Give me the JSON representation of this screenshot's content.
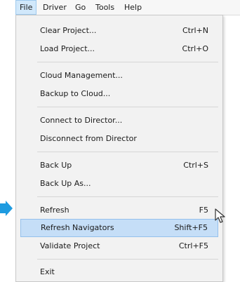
{
  "menubar": {
    "items": [
      {
        "label": "File"
      },
      {
        "label": "Driver"
      },
      {
        "label": "Go"
      },
      {
        "label": "Tools"
      },
      {
        "label": "Help"
      }
    ]
  },
  "file_menu": {
    "items": [
      {
        "label": "Clear Project...",
        "shortcut": "Ctrl+N"
      },
      {
        "label": "Load Project...",
        "shortcut": "Ctrl+O"
      },
      {
        "label": "Cloud Management...",
        "shortcut": ""
      },
      {
        "label": "Backup to Cloud...",
        "shortcut": ""
      },
      {
        "label": "Connect to Director...",
        "shortcut": ""
      },
      {
        "label": "Disconnect from Director",
        "shortcut": ""
      },
      {
        "label": "Back Up",
        "shortcut": "Ctrl+S"
      },
      {
        "label": "Back Up As...",
        "shortcut": ""
      },
      {
        "label": "Refresh",
        "shortcut": "F5"
      },
      {
        "label": "Refresh Navigators",
        "shortcut": "Shift+F5"
      },
      {
        "label": "Validate Project",
        "shortcut": "Ctrl+F5"
      },
      {
        "label": "Exit",
        "shortcut": ""
      }
    ]
  },
  "colors": {
    "highlight": "#c5def7",
    "pointer_arrow": "#1e9be0"
  },
  "icons": {
    "pointer": "arrow-right-icon",
    "cursor": "mouse-cursor-icon"
  }
}
